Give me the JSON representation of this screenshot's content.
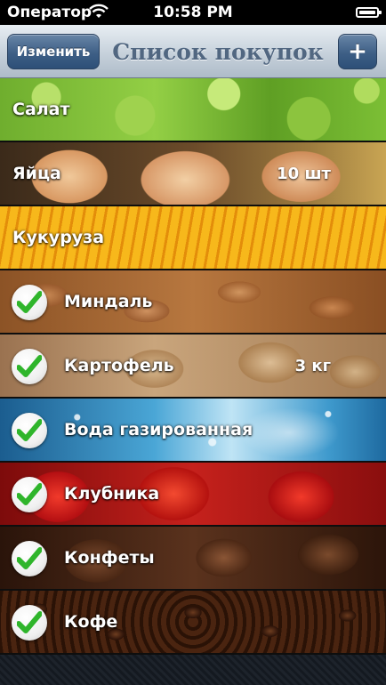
{
  "status_bar": {
    "carrier": "Оператор",
    "time": "10:58 PM"
  },
  "navbar": {
    "edit_label": "Изменить",
    "title": "Список покупок",
    "add_label": "+"
  },
  "items": [
    {
      "name": "Салат",
      "quantity": "",
      "checked": false,
      "background": "salad"
    },
    {
      "name": "Яйца",
      "quantity": "10 шт",
      "checked": false,
      "background": "eggs"
    },
    {
      "name": "Кукуруза",
      "quantity": "",
      "checked": false,
      "background": "corn"
    },
    {
      "name": "Миндаль",
      "quantity": "",
      "checked": true,
      "background": "almond"
    },
    {
      "name": "Картофель",
      "quantity": "3 кг",
      "checked": true,
      "background": "potato"
    },
    {
      "name": "Вода газированная",
      "quantity": "",
      "checked": true,
      "background": "water"
    },
    {
      "name": "Клубника",
      "quantity": "",
      "checked": true,
      "background": "strawberry"
    },
    {
      "name": "Конфеты",
      "quantity": "",
      "checked": true,
      "background": "candy"
    },
    {
      "name": "Кофе",
      "quantity": "",
      "checked": true,
      "background": "coffee"
    }
  ],
  "icons": {
    "checkmark": "checkmark-icon",
    "wifi": "wifi-icon",
    "battery": "battery-icon"
  },
  "colors": {
    "nav_button": "#3e5f86",
    "title": "#516781",
    "check_green": "#2fb52b"
  }
}
